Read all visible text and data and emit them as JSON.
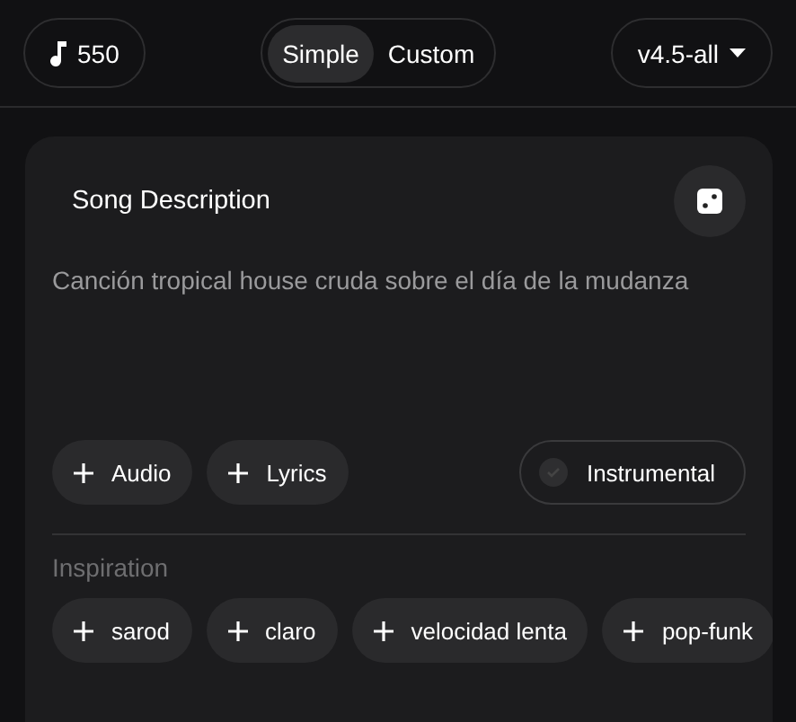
{
  "credits": "550",
  "modes": [
    {
      "label": "Simple",
      "selected": true
    },
    {
      "label": "Custom",
      "selected": false
    }
  ],
  "model": "v4.5-all",
  "card": {
    "title": "Song Description",
    "description": "Canción tropical house cruda sobre el día de la mudanza",
    "actions": [
      "Audio",
      "Lyrics"
    ],
    "instrumental": {
      "label": "Instrumental",
      "checked": false
    },
    "inspiration_label": "Inspiration",
    "tags": [
      "sarod",
      "claro",
      "velocidad lenta",
      "pop-funk"
    ]
  }
}
